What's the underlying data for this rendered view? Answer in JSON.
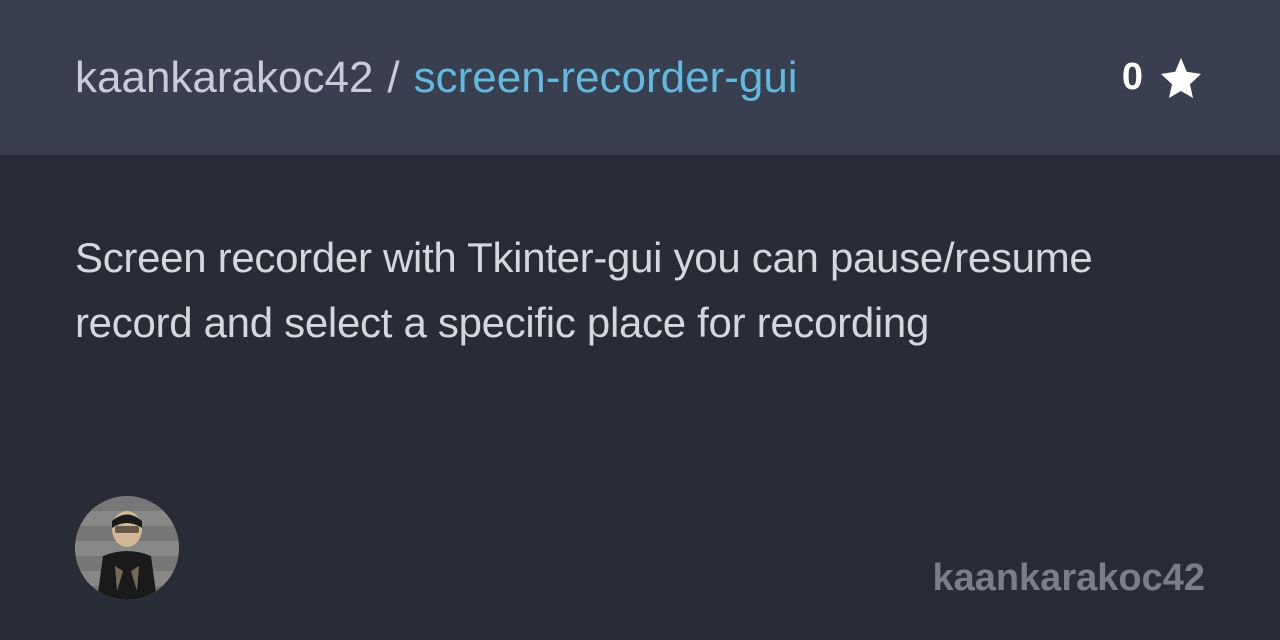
{
  "header": {
    "owner": "kaankarakoc42",
    "separator": "/",
    "repo": "screen-recorder-gui",
    "star_count": "0"
  },
  "content": {
    "description": "Screen recorder with Tkinter-gui you can pause/resume record and select a specific place for recording"
  },
  "footer": {
    "username": "kaankarakoc42"
  }
}
